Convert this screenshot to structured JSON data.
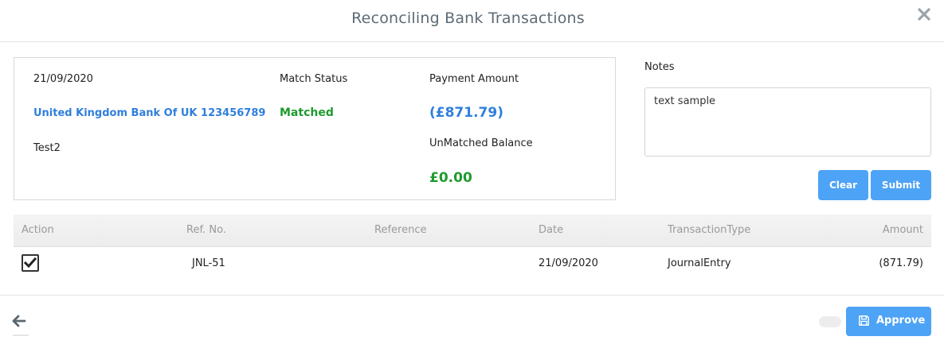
{
  "modal": {
    "title": "Reconciling Bank Transactions",
    "close_icon": "close-icon"
  },
  "transaction": {
    "date": "21/09/2020",
    "bank_account": "United Kingdom Bank Of UK 123456789",
    "description": "Test2",
    "match_status_label": "Match Status",
    "match_status_value": "Matched",
    "payment_amount_label": "Payment Amount",
    "payment_amount_value": "(£871.79)",
    "unmatched_balance_label": "UnMatched Balance",
    "unmatched_balance_value": "£0.00"
  },
  "notes": {
    "label": "Notes",
    "value": "text sample",
    "clear_label": "Clear",
    "submit_label": "Submit"
  },
  "table": {
    "columns": [
      "Action",
      "Ref. No.",
      "Reference",
      "Date",
      "TransactionType",
      "Amount"
    ],
    "rows": [
      {
        "checked": true,
        "ref_no": "JNL-51",
        "reference": "",
        "date": "21/09/2020",
        "transaction_type": "JournalEntry",
        "amount": "(871.79)"
      }
    ]
  },
  "footer": {
    "back_icon": "arrow-left-icon",
    "approve_icon": "save-icon",
    "approve_label": "Approve"
  },
  "colors": {
    "accent_blue": "#4da3f5",
    "link_blue": "#2f7fdc",
    "success_green": "#1e9b2e",
    "title_gray": "#5d6b76"
  }
}
